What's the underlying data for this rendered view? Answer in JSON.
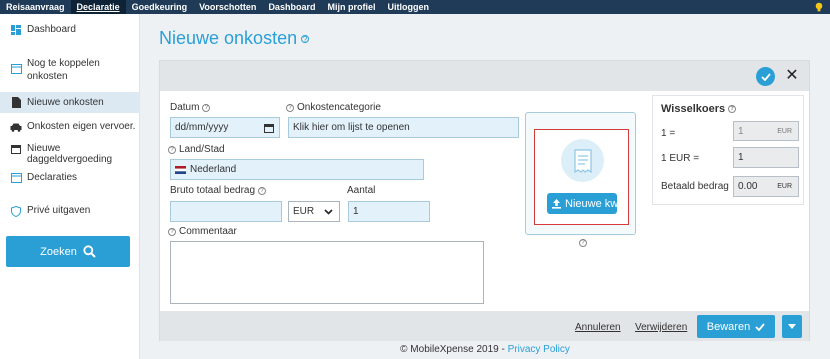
{
  "topnav": {
    "items": [
      "Reisaanvraag",
      "Declaratie",
      "Goedkeuring",
      "Voorschotten",
      "Dashboard",
      "Mijn profiel",
      "Uitloggen"
    ],
    "active": "Declaratie"
  },
  "sidebar": {
    "items": [
      {
        "label": "Dashboard",
        "icon": "dashboard-icon"
      },
      {
        "label": "Nog te koppelen",
        "label2": "onkosten",
        "icon": "window-icon"
      },
      {
        "label": "Nieuwe onkosten",
        "icon": "document-icon"
      },
      {
        "label": "Onkosten eigen vervoer.",
        "icon": "car-icon"
      },
      {
        "label": "Nieuwe daggeldvergoeding",
        "icon": "calendar-icon"
      },
      {
        "label": "Declaraties",
        "icon": "window-icon"
      },
      {
        "label": "Privé uitgaven",
        "icon": "shield-icon"
      }
    ],
    "search_label": "Zoeken"
  },
  "page": {
    "title": "Nieuwe onkosten"
  },
  "form": {
    "date_label": "Datum",
    "date_placeholder": "dd/mm/yyyy",
    "category_label": "Onkostencategorie",
    "category_value": "Klik hier om lijst te openen",
    "country_label": "Land/Stad",
    "country_value": "Nederland",
    "amount_label": "Bruto totaal bedrag",
    "currency_value": "EUR",
    "quantity_label": "Aantal",
    "quantity_value": "1",
    "comment_label": "Commentaar",
    "upload_label": "Nieuwe kw"
  },
  "exchange": {
    "title": "Wisselkoers",
    "row1_label": "1 =",
    "row1_value": "1",
    "row1_unit": "EUR",
    "row2_label": "1 EUR =",
    "row2_value": "1",
    "row3_label": "Betaald bedrag",
    "row3_value": "0.00",
    "row3_unit": "EUR"
  },
  "actions": {
    "cancel": "Annuleren",
    "delete": "Verwijderen",
    "save": "Bewaren"
  },
  "footer": {
    "copyright": "© MobileXpense 2019 - ",
    "privacy": "Privacy Policy"
  },
  "colors": {
    "accent": "#2a9fd6",
    "nav": "#1f3b57",
    "highlight": "#d63b3b"
  }
}
